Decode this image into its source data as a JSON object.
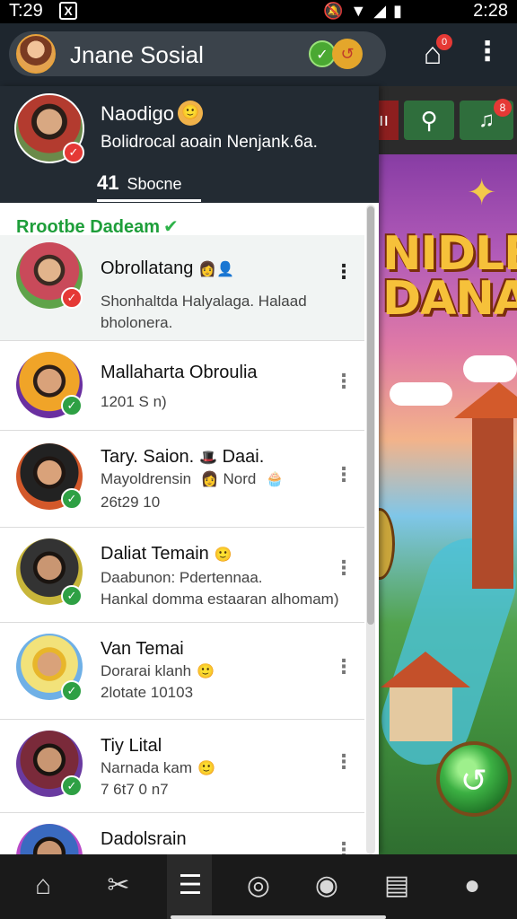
{
  "status_bar": {
    "time_left": "T:29",
    "notif_icon": "X",
    "system_icons": [
      "mute-icon",
      "wifi-icon",
      "signal-icon",
      "battery-icon"
    ],
    "time_right": "2:28"
  },
  "app_bar": {
    "title": "Jnane Sosial",
    "badge_green": "✓",
    "badge_gold": "↺",
    "home_badge_count": "0"
  },
  "profile": {
    "name": "Naodigo",
    "status": "Bolidrocal aoain Nenjank.6a.",
    "tab_count": "41",
    "tab_label": "Sbocne"
  },
  "section_title": "Rrootbe Dadeam",
  "contacts": [
    {
      "name": "Obrollatang",
      "line1": "Shonhaltda Halyalaga. Halaad",
      "line2": "bholonera.",
      "emoji": "👩👤",
      "badge": "red"
    },
    {
      "name": "Mallaharta Obroulia",
      "line1": "1201 S n)",
      "line2": "",
      "emoji": "",
      "badge": "green"
    },
    {
      "name": "Tary. Saion.",
      "name_suffix": "Daai.",
      "line1": "Mayoldrensin",
      "line1_suffix": "Nord",
      "line2": "26t29 10",
      "emoji": "🎩",
      "badge": "green"
    },
    {
      "name": "Daliat Temain",
      "line1": "Daabunon: Pdertennaa.",
      "line2": "Hankal domma estaaran alhomam)",
      "emoji": "🙂",
      "badge": "green"
    },
    {
      "name": "Van Temai",
      "line1": "Dorarai klanh",
      "line2": "2lotate 10103",
      "emoji": "🙂",
      "badge": "green"
    },
    {
      "name": "Tiy Lital",
      "line1": "Narnada kam",
      "line2": "7 6t7 0 n7",
      "emoji": "🙂",
      "badge": "green"
    },
    {
      "name": "Dadolsrain",
      "line1": "",
      "line2": "",
      "emoji": "",
      "badge": "green"
    }
  ],
  "game": {
    "logo_line1": "NIDLE",
    "logo_line2": "DANAIM",
    "tab_text": "ıı"
  },
  "bottom_nav": [
    {
      "name": "home-icon",
      "glyph": "⌂"
    },
    {
      "name": "tools-icon",
      "glyph": "✂"
    },
    {
      "name": "chat-icon",
      "glyph": "☰"
    },
    {
      "name": "ring-icon",
      "glyph": "◎"
    },
    {
      "name": "globe-icon",
      "glyph": "◉"
    },
    {
      "name": "news-icon",
      "glyph": "▤"
    },
    {
      "name": "profile-icon",
      "glyph": "●"
    }
  ],
  "colors": {
    "section_green": "#1e9e3a",
    "verified_green": "#2ea044",
    "header_dark": "#232b33"
  }
}
